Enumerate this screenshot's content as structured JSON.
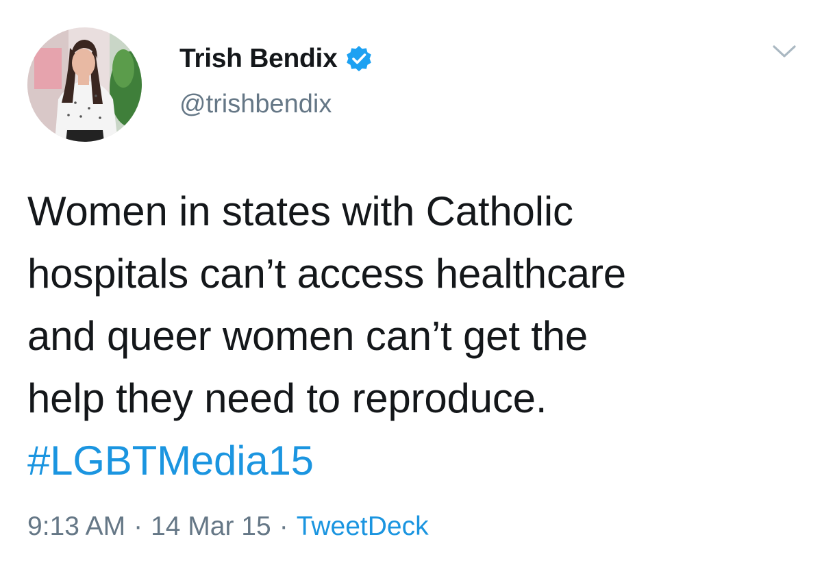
{
  "tweet": {
    "display_name": "Trish Bendix",
    "handle": "@trishbendix",
    "text_lines": [
      "Women in states with Catholic",
      "hospitals can’t access healthcare",
      "and queer women can’t get the",
      "help they need to reproduce."
    ],
    "hashtag": "#LGBTMedia15",
    "time": "9:13 AM",
    "date": "14 Mar 15",
    "source": "TweetDeck",
    "separator": "·"
  },
  "icons": {
    "verified": "verified-badge-icon",
    "menu": "chevron-down-icon"
  },
  "colors": {
    "text": "#14171a",
    "secondary": "#657786",
    "link": "#1b95e0",
    "verified": "#1da1f2"
  }
}
